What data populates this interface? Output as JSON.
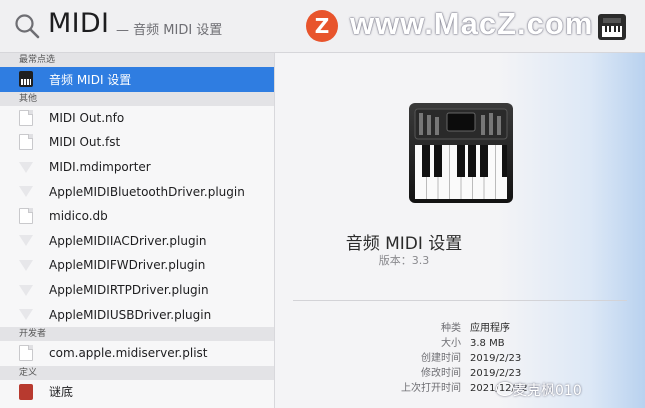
{
  "search": {
    "query": "MIDI",
    "hint": "— 音频 MIDI 设置"
  },
  "watermark": {
    "logo_letter": "Z",
    "site": "www.MacZ.com",
    "credit": "麦克枫010"
  },
  "colors": {
    "selection": "#2f7de1",
    "section_header_bg": "#e3e3e6"
  },
  "sections": [
    {
      "header": "最常点选",
      "items": [
        {
          "label": "音频 MIDI 设置",
          "icon": "midi-app-icon",
          "selected": true
        }
      ]
    },
    {
      "header": "其他",
      "items": [
        {
          "label": "MIDI Out.nfo",
          "icon": "document-icon"
        },
        {
          "label": "MIDI Out.fst",
          "icon": "document-icon"
        },
        {
          "label": "MIDI.mdimporter",
          "icon": "plugin-icon"
        },
        {
          "label": "AppleMIDIBluetoothDriver.plugin",
          "icon": "plugin-icon"
        },
        {
          "label": "midico.db",
          "icon": "document-icon"
        },
        {
          "label": "AppleMIDIIACDriver.plugin",
          "icon": "plugin-icon"
        },
        {
          "label": "AppleMIDIFWDriver.plugin",
          "icon": "plugin-icon"
        },
        {
          "label": "AppleMIDIRTPDriver.plugin",
          "icon": "plugin-icon"
        },
        {
          "label": "AppleMIDIUSBDriver.plugin",
          "icon": "plugin-icon"
        }
      ]
    },
    {
      "header": "开发者",
      "items": [
        {
          "label": "com.apple.midiserver.plist",
          "icon": "document-icon"
        }
      ]
    },
    {
      "header": "定义",
      "items": [
        {
          "label": "谜底",
          "icon": "dictionary-icon"
        }
      ]
    }
  ],
  "preview": {
    "app_name": "音频 MIDI 设置",
    "version": "版本：3.3",
    "metadata": [
      {
        "label": "种类",
        "value": "应用程序"
      },
      {
        "label": "大小",
        "value": "3.8 MB"
      },
      {
        "label": "创建时间",
        "value": "2019/2/23"
      },
      {
        "label": "修改时间",
        "value": "2019/2/23"
      },
      {
        "label": "上次打开时间",
        "value": "2021/12/12"
      }
    ]
  }
}
